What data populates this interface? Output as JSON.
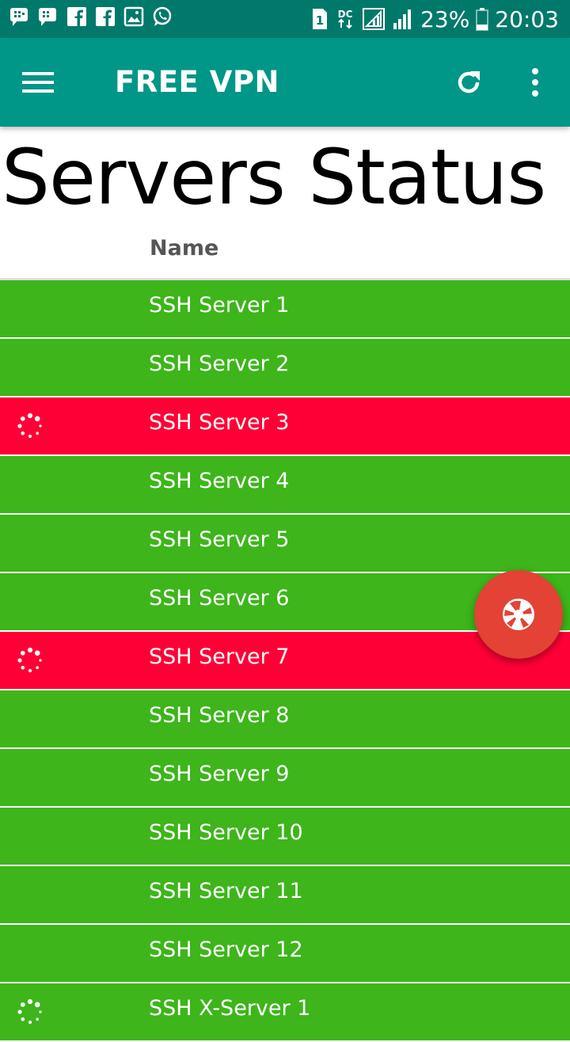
{
  "status_bar": {
    "battery": "23%",
    "time": "20:03",
    "sim": "1",
    "network": "DC"
  },
  "app_bar": {
    "title": "FREE VPN"
  },
  "page": {
    "title": "Servers Status",
    "column_header": "Name"
  },
  "servers": [
    {
      "name": "SSH Server 1",
      "status": "up"
    },
    {
      "name": "SSH Server 2",
      "status": "up"
    },
    {
      "name": "SSH Server 3",
      "status": "down"
    },
    {
      "name": "SSH Server 4",
      "status": "up"
    },
    {
      "name": "SSH Server 5",
      "status": "up"
    },
    {
      "name": "SSH Server 6",
      "status": "up"
    },
    {
      "name": "SSH Server 7",
      "status": "down"
    },
    {
      "name": "SSH Server 8",
      "status": "up"
    },
    {
      "name": "SSH Server 9",
      "status": "up"
    },
    {
      "name": "SSH Server 10",
      "status": "up"
    },
    {
      "name": "SSH Server 11",
      "status": "up"
    },
    {
      "name": "SSH Server 12",
      "status": "up"
    },
    {
      "name": "SSH X-Server 1",
      "status": "up-loading"
    }
  ],
  "colors": {
    "status_bar": "#00796b",
    "app_bar": "#009688",
    "row_up": "#3db51b",
    "row_down": "#ff0036",
    "fab": "#e34234"
  },
  "icons": {
    "menu": "hamburger-icon",
    "refresh": "refresh-icon",
    "more": "more-vert-icon",
    "fab": "camera-aperture-icon"
  }
}
